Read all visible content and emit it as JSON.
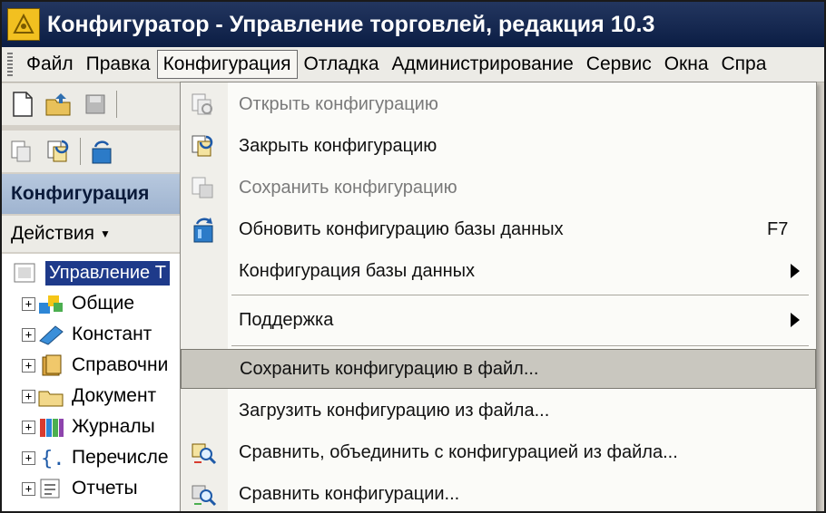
{
  "window": {
    "title": "Конфигуратор - Управление торговлей, редакция 10.3"
  },
  "menubar": {
    "items": [
      "Файл",
      "Правка",
      "Конфигурация",
      "Отладка",
      "Администрирование",
      "Сервис",
      "Окна",
      "Спра"
    ],
    "active": "Конфигурация"
  },
  "panel": {
    "header": "Конфигурация",
    "actions_label": "Действия",
    "tree_root": "Управление Т",
    "tree_items": [
      "Общие",
      "Констант",
      "Справочни",
      "Документ",
      "Журналы",
      "Перечисле",
      "Отчеты"
    ]
  },
  "dropdown": {
    "items": [
      {
        "label": "Открыть конфигурацию",
        "disabled": true,
        "icon": "open-config-icon"
      },
      {
        "label": "Закрыть конфигурацию",
        "disabled": false,
        "icon": "close-config-icon"
      },
      {
        "label": "Сохранить конфигурацию",
        "disabled": true,
        "icon": "save-config-icon"
      },
      {
        "label": "Обновить конфигурацию базы данных",
        "shortcut": "F7",
        "disabled": false,
        "icon": "update-db-icon"
      },
      {
        "label": "Конфигурация базы данных",
        "submenu": true,
        "disabled": false
      },
      {
        "label": "Поддержка",
        "submenu": true,
        "disabled": false
      },
      {
        "label": "Сохранить конфигурацию в файл...",
        "highlighted": true,
        "disabled": false
      },
      {
        "label": "Загрузить конфигурацию из файла...",
        "disabled": false
      },
      {
        "label": "Сравнить, объединить с конфигурацией из файла...",
        "disabled": false,
        "icon": "compare-merge-icon"
      },
      {
        "label": "Сравнить конфигурации...",
        "disabled": false,
        "icon": "compare-icon"
      }
    ]
  },
  "colors": {
    "titlebar": "#0b1d44",
    "highlight": "#c9c7bf",
    "tree_selection": "#1e3a8a"
  }
}
